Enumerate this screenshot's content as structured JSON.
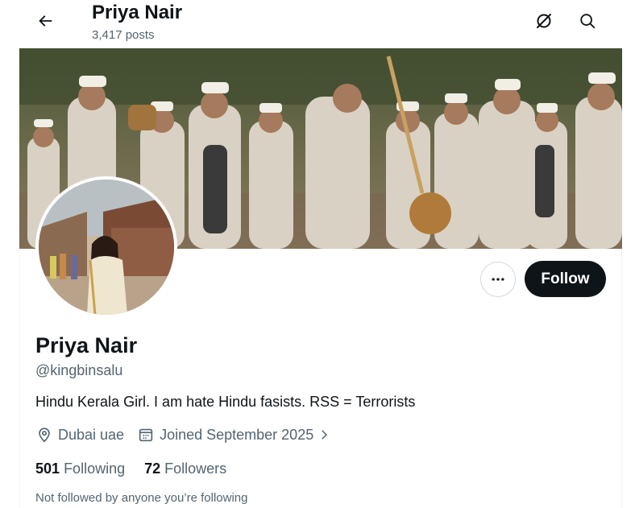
{
  "header": {
    "title": "Priya Nair",
    "post_count": "3,417 posts"
  },
  "icons": {
    "back": "arrow-left-icon",
    "grok": "grok-icon",
    "search": "search-icon",
    "more": "more-dots-icon",
    "location": "location-pin-icon",
    "calendar": "calendar-icon",
    "chevron": "chevron-right-icon"
  },
  "profile": {
    "display_name": "Priya Nair",
    "handle": "@kingbinsalu",
    "bio": "Hindu Kerala Girl. I am hate Hindu fasists. RSS = Terrorists",
    "location": "Dubai uae",
    "joined": "Joined September 2025",
    "following_count": "501",
    "following_label": "Following",
    "followers_count": "72",
    "followers_label": "Followers",
    "follow_notice": "Not followed by anyone you’re following"
  },
  "actions": {
    "follow_label": "Follow"
  },
  "colors": {
    "text_primary": "#0f1419",
    "text_secondary": "#536471",
    "button_dark": "#0f1419",
    "border": "#cfd9de"
  }
}
